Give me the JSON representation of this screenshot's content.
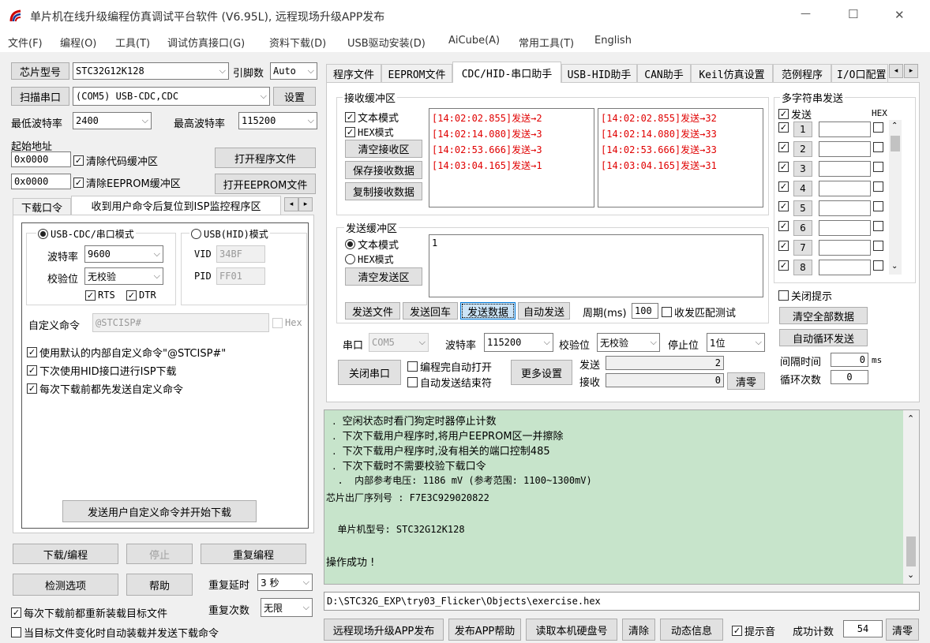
{
  "window": {
    "title": "单片机在线升级编程仿真调试平台软件 (V6.95L), 远程现场升级APP发布",
    "min": "—",
    "max": "☐",
    "close": "✕"
  },
  "menu": [
    "文件(F)",
    "编程(O)",
    "工具(T)",
    "调试仿真接口(G)",
    "资料下载(D)",
    "USB驱动安装(D)",
    "AiCube(A)",
    "常用工具(T)",
    "English"
  ],
  "left": {
    "chip_btn": "芯片型号",
    "chip_value": "STC32G12K128",
    "pins_label": "引脚数",
    "pins_value": "Auto",
    "scan_btn": "扫描串口",
    "port_value": "(COM5) USB-CDC,CDC",
    "settings_btn": "设置",
    "min_baud_label": "最低波特率",
    "min_baud": "2400",
    "max_baud_label": "最高波特率",
    "max_baud": "115200",
    "start_addr_label": "起始地址",
    "addr1": "0x0000",
    "clear_code": "清除代码缓冲区",
    "open_prog_btn": "打开程序文件",
    "addr2": "0x0000",
    "clear_eeprom": "清除EEPROM缓冲区",
    "open_eeprom_btn": "打开EEPROM文件",
    "tab1": "下载口令",
    "tab2": "收到用户命令后复位到ISP监控程序区",
    "usb_cdc_mode": "USB-CDC/串口模式",
    "usb_hid_mode": "USB(HID)模式",
    "baud_label": "波特率",
    "baud_value": "9600",
    "parity_label": "校验位",
    "parity_value": "无校验",
    "vid_label": "VID",
    "vid_value": "34BF",
    "pid_label": "PID",
    "pid_value": "FF01",
    "rts": "RTS",
    "dtr": "DTR",
    "custom_cmd_label": "自定义命令",
    "custom_cmd_value": "@STCISP#",
    "hex_label": "Hex",
    "opt1": "使用默认的内部自定义命令\"@STCISP#\"",
    "opt2": "下次使用HID接口进行ISP下载",
    "opt3": "每次下载前都先发送自定义命令",
    "send_cmd_btn": "发送用户自定义命令并开始下载",
    "download_btn": "下载/编程",
    "stop_btn": "停止",
    "reprog_btn": "重复编程",
    "check_btn": "检测选项",
    "help_btn": "帮助",
    "delay_label": "重复延时",
    "delay_value": "3 秒",
    "count_label": "重复次数",
    "count_value": "无限",
    "reload_opt": "每次下载前都重新装载目标文件",
    "auto_opt": "当目标文件变化时自动装载并发送下载命令"
  },
  "tabs": [
    "程序文件",
    "EEPROM文件",
    "CDC/HID-串口助手",
    "USB-HID助手",
    "CAN助手",
    "Keil仿真设置",
    "范例程序",
    "I/O口配置"
  ],
  "recv": {
    "group": "接收缓冲区",
    "text_mode": "文本模式",
    "hex_mode": "HEX模式",
    "clear_btn": "清空接收区",
    "save_btn": "保存接收数据",
    "copy_btn": "复制接收数据",
    "lines_a": [
      "[14:02:02.855]发送→2",
      "[14:02:14.080]发送→3",
      "[14:02:53.666]发送→3",
      "[14:03:04.165]发送→1"
    ],
    "lines_b": [
      "[14:02:02.855]发送→32",
      "[14:02:14.080]发送→33",
      "[14:02:53.666]发送→33",
      "[14:03:04.165]发送→31"
    ]
  },
  "send": {
    "group": "发送缓冲区",
    "text_mode": "文本模式",
    "hex_mode": "HEX模式",
    "clear_btn": "清空发送区",
    "content": "1",
    "file_btn": "发送文件",
    "cr_btn": "发送回车",
    "data_btn": "发送数据",
    "auto_btn": "自动发送",
    "period_label": "周期(ms)",
    "period_value": "100",
    "match_label": "收发匹配测试"
  },
  "port": {
    "port_label": "串口",
    "port_value": "COM5",
    "baud_label": "波特率",
    "baud_value": "115200",
    "parity_label": "校验位",
    "parity_value": "无校验",
    "stop_label": "停止位",
    "stop_value": "1位",
    "close_btn": "关闭串口",
    "auto_open": "编程完自动打开",
    "auto_end": "自动发送结束符",
    "more_btn": "更多设置",
    "tx_label": "发送",
    "tx_value": "2",
    "rx_label": "接收",
    "rx_value": "0",
    "clear_btn": "清零"
  },
  "multi": {
    "group": "多字符串发送",
    "send_label": "发送",
    "hex_label": "HEX",
    "rows": [
      "1",
      "2",
      "3",
      "4",
      "5",
      "6",
      "7",
      "8"
    ],
    "close_tip": "关闭提示",
    "clear_all_btn": "清空全部数据",
    "loop_btn": "自动循环发送",
    "interval_label": "间隔时间",
    "interval_value": "0",
    "interval_unit": "ms",
    "loop_count_label": "循环次数",
    "loop_count_value": "0"
  },
  "log": [
    "  .  空闲状态时看门狗定时器停止计数",
    "  .  下次下载用户程序时,将用户EEPROM区一并擦除",
    "  .  下次下载用户程序时,没有相关的端口控制485",
    "  .  下次下载时不需要校验下载口令",
    "  .  内部参考电压: 1186 mV (参考范围: 1100~1300mV)",
    "芯片出厂序列号 : F7E3C929020822",
    "",
    "  单片机型号: STC32G12K128",
    "",
    "操作成功 !"
  ],
  "path": "D:\\STC32G_EXP\\try03_Flicker\\Objects\\exercise.hex",
  "bottom": {
    "remote_btn": "远程现场升级APP发布",
    "help_btn": "发布APP帮助",
    "disk_btn": "读取本机硬盘号",
    "clear_btn": "清除",
    "dynamic_btn": "动态信息",
    "sound": "提示音",
    "success_label": "成功计数",
    "success_value": "54",
    "zero_btn": "清零"
  }
}
